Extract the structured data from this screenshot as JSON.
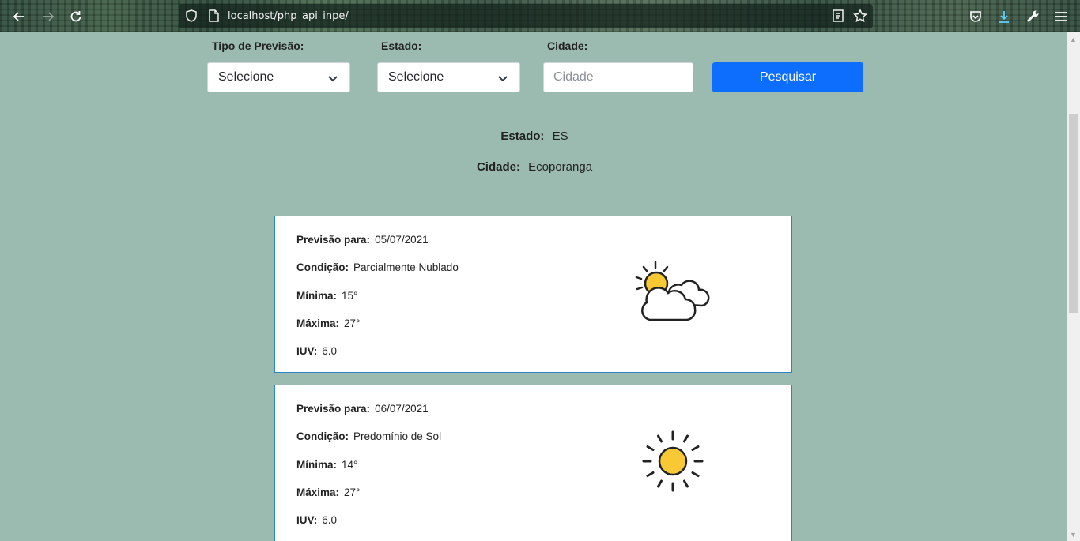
{
  "browser": {
    "url": "localhost/php_api_inpe/"
  },
  "form": {
    "tipo_label": "Tipo de Previsão:",
    "tipo_value": "Selecione",
    "estado_label": "Estado:",
    "estado_value": "Selecione",
    "cidade_label": "Cidade:",
    "cidade_placeholder": "Cidade",
    "search_label": "Pesquisar"
  },
  "location": {
    "estado_label": "Estado:",
    "estado_value": "ES",
    "cidade_label": "Cidade:",
    "cidade_value": "Ecoporanga"
  },
  "forecasts": [
    {
      "date_label": "Previsão para:",
      "date": "05/07/2021",
      "condition_label": "Condição:",
      "condition": "Parcialmente Nublado",
      "min_label": "Mínima:",
      "min": "15°",
      "max_label": "Máxima:",
      "max": "27°",
      "iuv_label": "IUV:",
      "iuv": "6.0",
      "icon": "partly-cloudy-icon"
    },
    {
      "date_label": "Previsão para:",
      "date": "06/07/2021",
      "condition_label": "Condição:",
      "condition": "Predomínio de Sol",
      "min_label": "Mínima:",
      "min": "14°",
      "max_label": "Máxima:",
      "max": "27°",
      "iuv_label": "IUV:",
      "iuv": "6.0",
      "icon": "sun-icon"
    }
  ],
  "colors": {
    "page_bg": "#9bbbb1",
    "primary": "#0d6efd",
    "card_border": "#2a86c8",
    "sun": "#f9c935"
  }
}
